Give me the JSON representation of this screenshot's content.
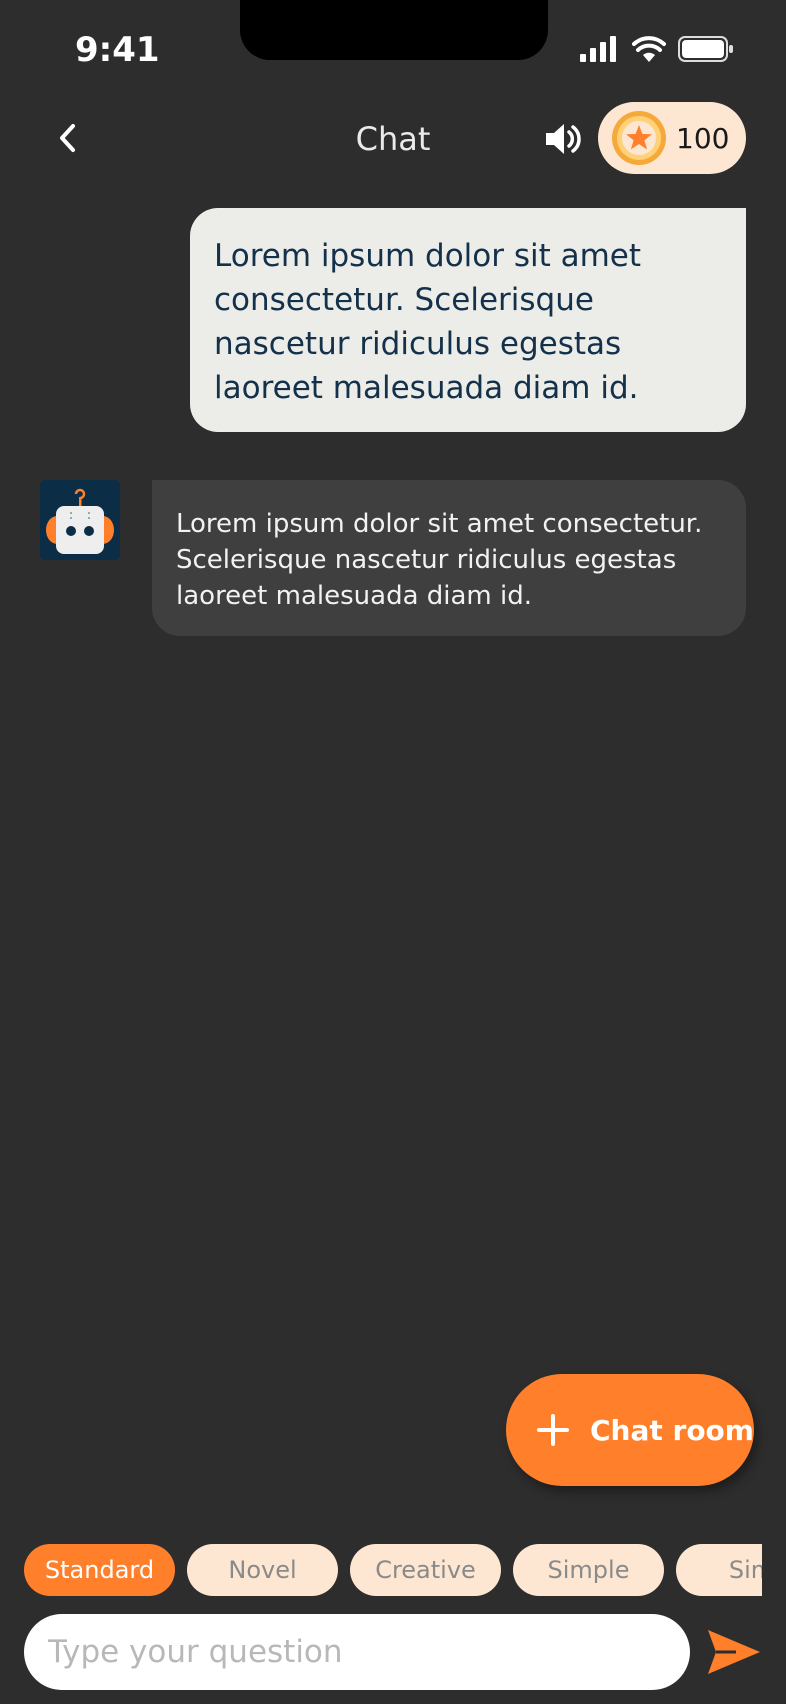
{
  "status_bar": {
    "time": "9:41"
  },
  "header": {
    "title": "Chat",
    "coins": "100"
  },
  "messages": {
    "user": "Lorem ipsum dolor sit amet consectetur. Scelerisque nascetur ridiculus egestas laoreet malesuada diam id.",
    "bot": "Lorem ipsum dolor sit amet consectetur. Scelerisque nascetur ridiculus egestas laoreet malesuada diam id."
  },
  "chat_room_button": {
    "label": "Chat room"
  },
  "modes": {
    "items": [
      "Standard",
      "Novel",
      "Creative",
      "Simple",
      "Sim"
    ],
    "selected": "Standard"
  },
  "composer": {
    "placeholder": "Type your question",
    "value": ""
  },
  "colors": {
    "accent": "#ff7f2a",
    "background": "#2d2d2d",
    "chip": "#fde7d2"
  },
  "icons": [
    "back-icon",
    "volume-icon",
    "coin-star-icon",
    "robot-avatar-icon",
    "plus-icon",
    "send-icon",
    "signal-icon",
    "wifi-icon",
    "battery-icon"
  ]
}
